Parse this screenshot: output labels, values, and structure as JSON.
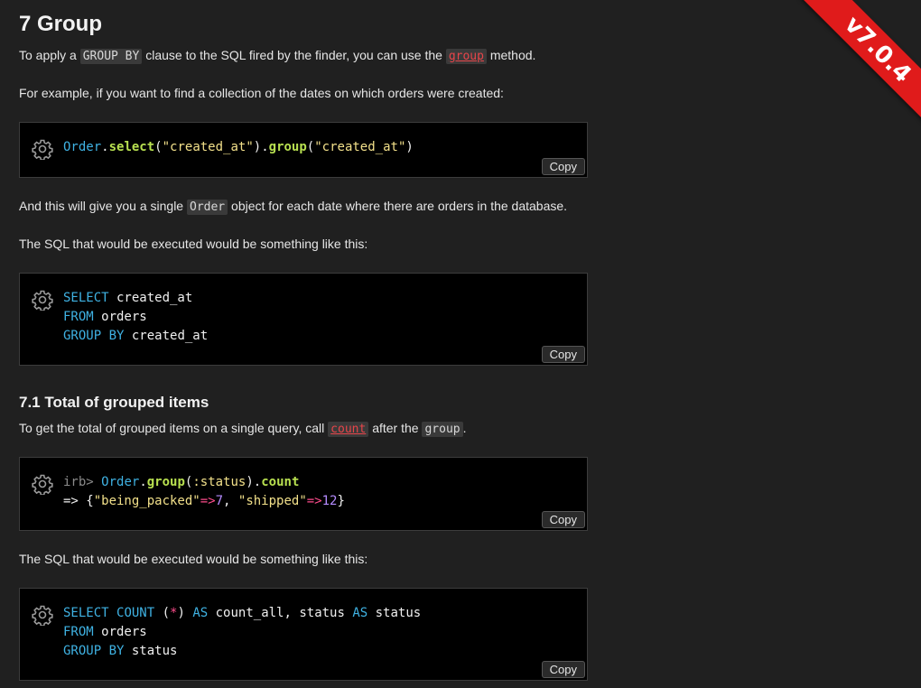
{
  "version_badge": "v7.0.4",
  "section": {
    "title": "7 Group",
    "intro_pre": "To apply a ",
    "intro_code1": "GROUP BY",
    "intro_mid": " clause to the SQL fired by the finder, you can use the ",
    "intro_link": "group",
    "intro_post": " method.",
    "example_text": "For example, if you want to find a collection of the dates on which orders were created:",
    "single_pre": "And this will give you a single ",
    "single_code": "Order",
    "single_post": " object for each date where there are orders in the database.",
    "sql_text": "The SQL that would be executed would be something like this:"
  },
  "subsection": {
    "title": "7.1 Total of grouped items",
    "intro_pre": "To get the total of grouped items on a single query, call ",
    "intro_link": "count",
    "intro_mid": " after the ",
    "intro_code": "group",
    "intro_post": ".",
    "sql_text": "The SQL that would be executed would be something like this:"
  },
  "copy_label": "Copy",
  "code": {
    "ruby1": {
      "cls": "Order",
      "dot1": ".",
      "m1": "select",
      "a1": "(",
      "s1": "\"created_at\"",
      "a2": ")",
      "dot2": ".",
      "m2": "group",
      "a3": "(",
      "s2": "\"created_at\"",
      "a4": ")"
    },
    "sql1": {
      "l1k": "SELECT",
      "l1v": " created_at",
      "l2k": "FROM",
      "l2v": " orders",
      "l3k": "GROUP BY",
      "l3v": " created_at"
    },
    "irb": {
      "prompt": "irb> ",
      "cls": "Order",
      "dot1": ".",
      "m1": "group",
      "p1": "(",
      "sym": ":status",
      "p2": ")",
      "dot2": ".",
      "m2": "count",
      "arrow": "=> {",
      "k1": "\"being_packed\"",
      "op1": "=>",
      "v1": "7",
      "comma": ", ",
      "k2": "\"shipped\"",
      "op2": "=>",
      "v2": "12",
      "close": "}"
    },
    "sql2": {
      "l1k1": "SELECT",
      "l1k2": "COUNT",
      "l1a": " (",
      "l1op": "*",
      "l1b": ") ",
      "l1k3": "AS",
      "l1c": " count_all, status ",
      "l1k4": "AS",
      "l1d": " status",
      "l2k": "FROM",
      "l2v": " orders",
      "l3k": "GROUP BY",
      "l3v": " status"
    }
  },
  "icons": {
    "gear": "gear-icon"
  }
}
